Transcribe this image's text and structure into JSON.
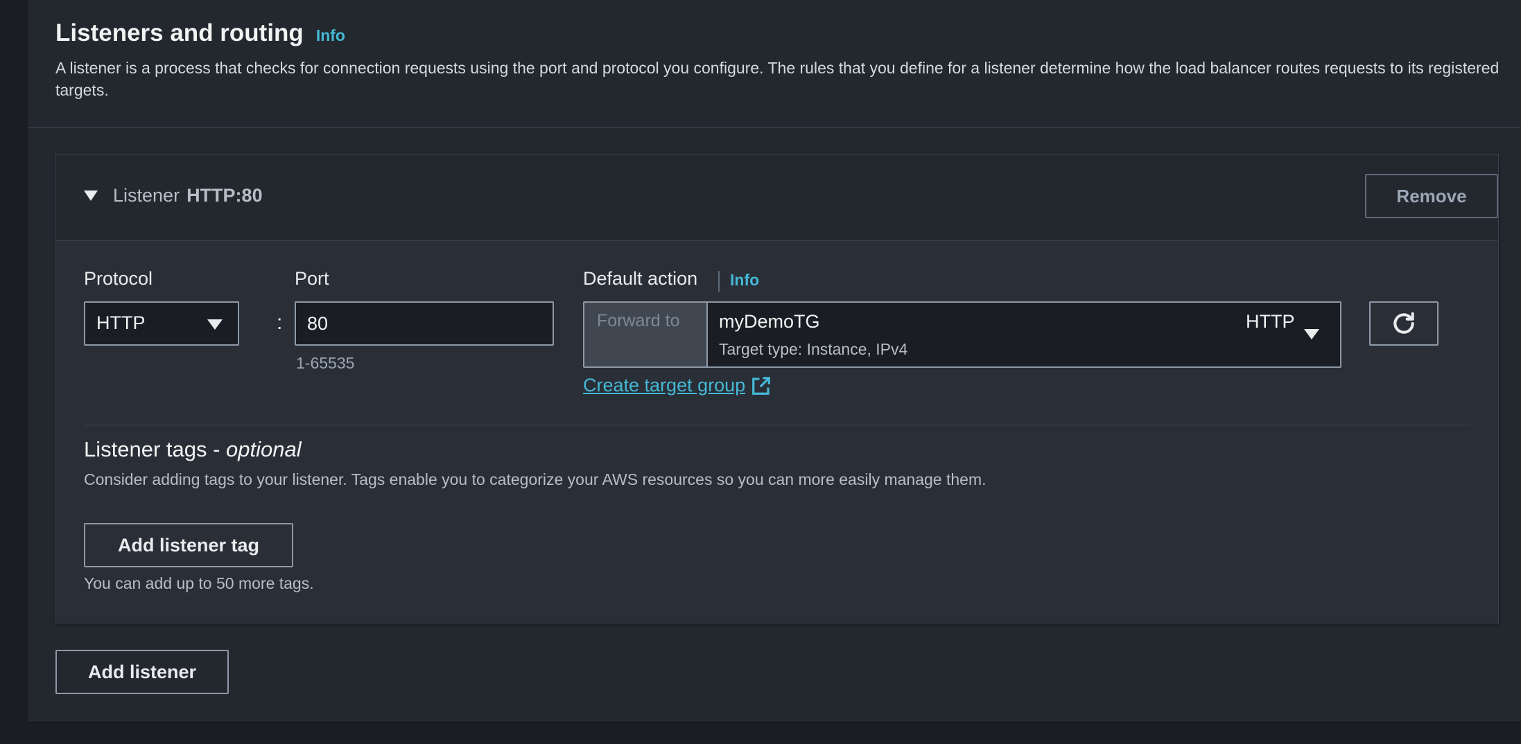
{
  "section": {
    "title": "Listeners and routing",
    "info_label": "Info",
    "description": "A listener is a process that checks for connection requests using the port and protocol you configure. The rules that you define for a listener determine how the load balancer routes requests to its registered targets."
  },
  "listener": {
    "label": "Listener",
    "name": "HTTP:80",
    "remove_label": "Remove",
    "protocol": {
      "label": "Protocol",
      "value": "HTTP"
    },
    "port": {
      "label": "Port",
      "value": "80",
      "hint": "1-65535"
    },
    "separator": ":",
    "default_action": {
      "label": "Default action",
      "info_label": "Info",
      "forward_label": "Forward to",
      "target_group_name": "myDemoTG",
      "target_group_protocol": "HTTP",
      "target_type": "Target type: Instance, IPv4",
      "create_link": "Create target group"
    },
    "tags": {
      "title": "Listener tags - ",
      "title_optional": "optional",
      "description": "Consider adding tags to your listener. Tags enable you to categorize your AWS resources so you can more easily manage them.",
      "add_button": "Add listener tag",
      "limit_hint": "You can add up to 50 more tags."
    }
  },
  "add_listener_label": "Add listener",
  "colors": {
    "background": "#1a1d23",
    "panel": "#23272e",
    "link": "#44b9d6",
    "border": "#8d99a8"
  },
  "icons": [
    "caret-down-icon",
    "dropdown-arrow-icon",
    "refresh-icon",
    "external-link-icon"
  ]
}
